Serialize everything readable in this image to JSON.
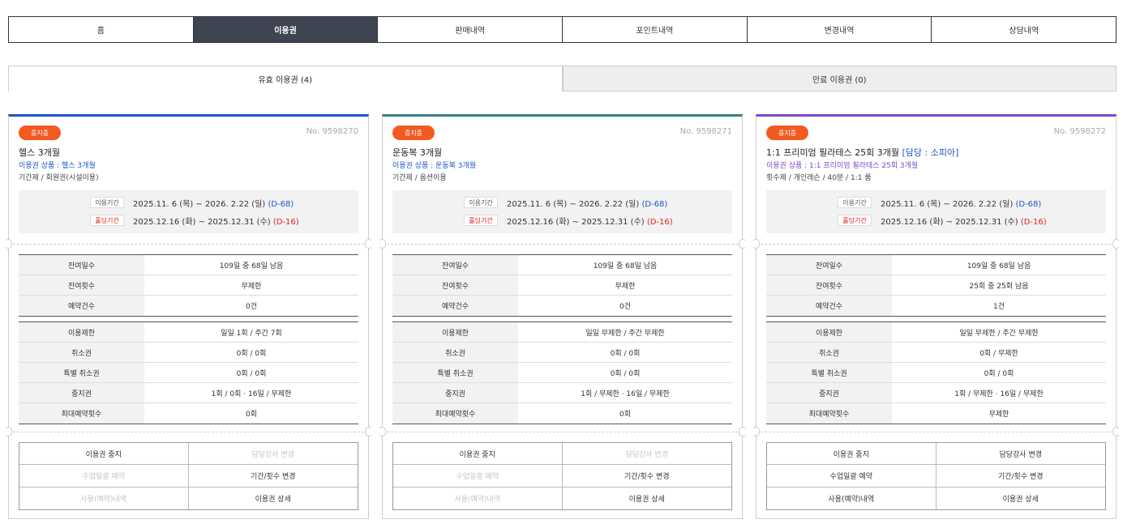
{
  "nav": {
    "tabs": [
      "홈",
      "이용권",
      "판매내역",
      "포인트내역",
      "변경내역",
      "상담내역"
    ],
    "active": 1
  },
  "subtabs": {
    "valid": "유효 이용권 (4)",
    "expired": "만료 이용권 (0)"
  },
  "colors": {
    "accent_blue": "#1a55c7",
    "accent_teal": "#3a7e86",
    "accent_purple": "#7a4bc7",
    "badge": "#f25a22",
    "red": "#d9261c",
    "nav_active": "#3f4453"
  },
  "cards": [
    {
      "badge": "중지중",
      "no": "No. 9598270",
      "title": "헬스 3개월",
      "teacher": "",
      "product": "이용권 상품 : 헬스 3개월",
      "meta": "기간제 / 회원권(시설이용)",
      "period_label": "이용기간",
      "period": "2025.11. 6 (목) ~ 2026. 2.22 (일)",
      "period_dday": "(D-68)",
      "hold_label": "홀딩기간",
      "hold": "2025.12.16 (화) ~ 2025.12.31 (수)",
      "hold_dday": "(D-16)",
      "table1": [
        {
          "k": "잔여일수",
          "v": "109일 중 68일 남음"
        },
        {
          "k": "잔여횟수",
          "v": "무제한"
        },
        {
          "k": "예약건수",
          "v": "0건"
        }
      ],
      "table2": [
        {
          "k": "이용제한",
          "v": "일일 1회 / 주간 7회"
        },
        {
          "k": "취소권",
          "v": "0회 / 0회"
        },
        {
          "k": "특별 취소권",
          "v": "0회 / 0회"
        },
        {
          "k": "중지권",
          "v": "1회 / 0회 · 16일 / 무제한"
        },
        {
          "k": "최대예약횟수",
          "v": "0회"
        }
      ],
      "actions": [
        {
          "label": "이용권 중지",
          "enabled": true
        },
        {
          "label": "담당강사 변경",
          "enabled": false
        },
        {
          "label": "수업일괄 예약",
          "enabled": false
        },
        {
          "label": "기간/횟수 변경",
          "enabled": true
        },
        {
          "label": "사용(예약)내역",
          "enabled": false
        },
        {
          "label": "이용권 상세",
          "enabled": true
        }
      ]
    },
    {
      "badge": "중지중",
      "no": "No. 9598271",
      "title": "운동복 3개월",
      "teacher": "",
      "product": "이용권 상품 : 운동복 3개월",
      "meta": "기간제 / 옵션이용",
      "period_label": "이용기간",
      "period": "2025.11. 6 (목) ~ 2026. 2.22 (일)",
      "period_dday": "(D-68)",
      "hold_label": "홀딩기간",
      "hold": "2025.12.16 (화) ~ 2025.12.31 (수)",
      "hold_dday": "(D-16)",
      "table1": [
        {
          "k": "잔여일수",
          "v": "109일 중 68일 남음"
        },
        {
          "k": "잔여횟수",
          "v": "무제한"
        },
        {
          "k": "예약건수",
          "v": "0건"
        }
      ],
      "table2": [
        {
          "k": "이용제한",
          "v": "일일 무제한 / 주간 무제한"
        },
        {
          "k": "취소권",
          "v": "0회 / 0회"
        },
        {
          "k": "특별 취소권",
          "v": "0회 / 0회"
        },
        {
          "k": "중지권",
          "v": "1회 / 무제한 · 16일 / 무제한"
        },
        {
          "k": "최대예약횟수",
          "v": "0회"
        }
      ],
      "actions": [
        {
          "label": "이용권 중지",
          "enabled": true
        },
        {
          "label": "담당강사 변경",
          "enabled": false
        },
        {
          "label": "수업일괄 예약",
          "enabled": false
        },
        {
          "label": "기간/횟수 변경",
          "enabled": true
        },
        {
          "label": "사용(예약)내역",
          "enabled": false
        },
        {
          "label": "이용권 상세",
          "enabled": true
        }
      ]
    },
    {
      "badge": "중지중",
      "no": "No. 9598272",
      "title": "1:1 프리미엄 필라테스 25회 3개월",
      "teacher": "[담당 : 소피아]",
      "product": "이용권 상품 : 1:1 프리미엄 필라테스 25회 3개월",
      "meta": "횟수제 / 개인레슨 / 40분 / 1:1 룸",
      "period_label": "이용기간",
      "period": "2025.11. 6 (목) ~ 2026. 2.22 (일)",
      "period_dday": "(D-68)",
      "hold_label": "홀딩기간",
      "hold": "2025.12.16 (화) ~ 2025.12.31 (수)",
      "hold_dday": "(D-16)",
      "table1": [
        {
          "k": "잔여일수",
          "v": "109일 중 68일 남음"
        },
        {
          "k": "잔여횟수",
          "v": "25회 중 25회 남음"
        },
        {
          "k": "예약건수",
          "v": "1건"
        }
      ],
      "table2": [
        {
          "k": "이용제한",
          "v": "일일 무제한 / 주간 무제한"
        },
        {
          "k": "취소권",
          "v": "0회 / 무제한"
        },
        {
          "k": "특별 취소권",
          "v": "0회 / 0회"
        },
        {
          "k": "중지권",
          "v": "1회 / 무제한 · 16일 / 무제한"
        },
        {
          "k": "최대예약횟수",
          "v": "무제한"
        }
      ],
      "actions": [
        {
          "label": "이용권 중지",
          "enabled": true
        },
        {
          "label": "담당강사 변경",
          "enabled": true
        },
        {
          "label": "수업일괄 예약",
          "enabled": true
        },
        {
          "label": "기간/횟수 변경",
          "enabled": true
        },
        {
          "label": "사용(예약)내역",
          "enabled": true
        },
        {
          "label": "이용권 상세",
          "enabled": true
        }
      ]
    }
  ]
}
